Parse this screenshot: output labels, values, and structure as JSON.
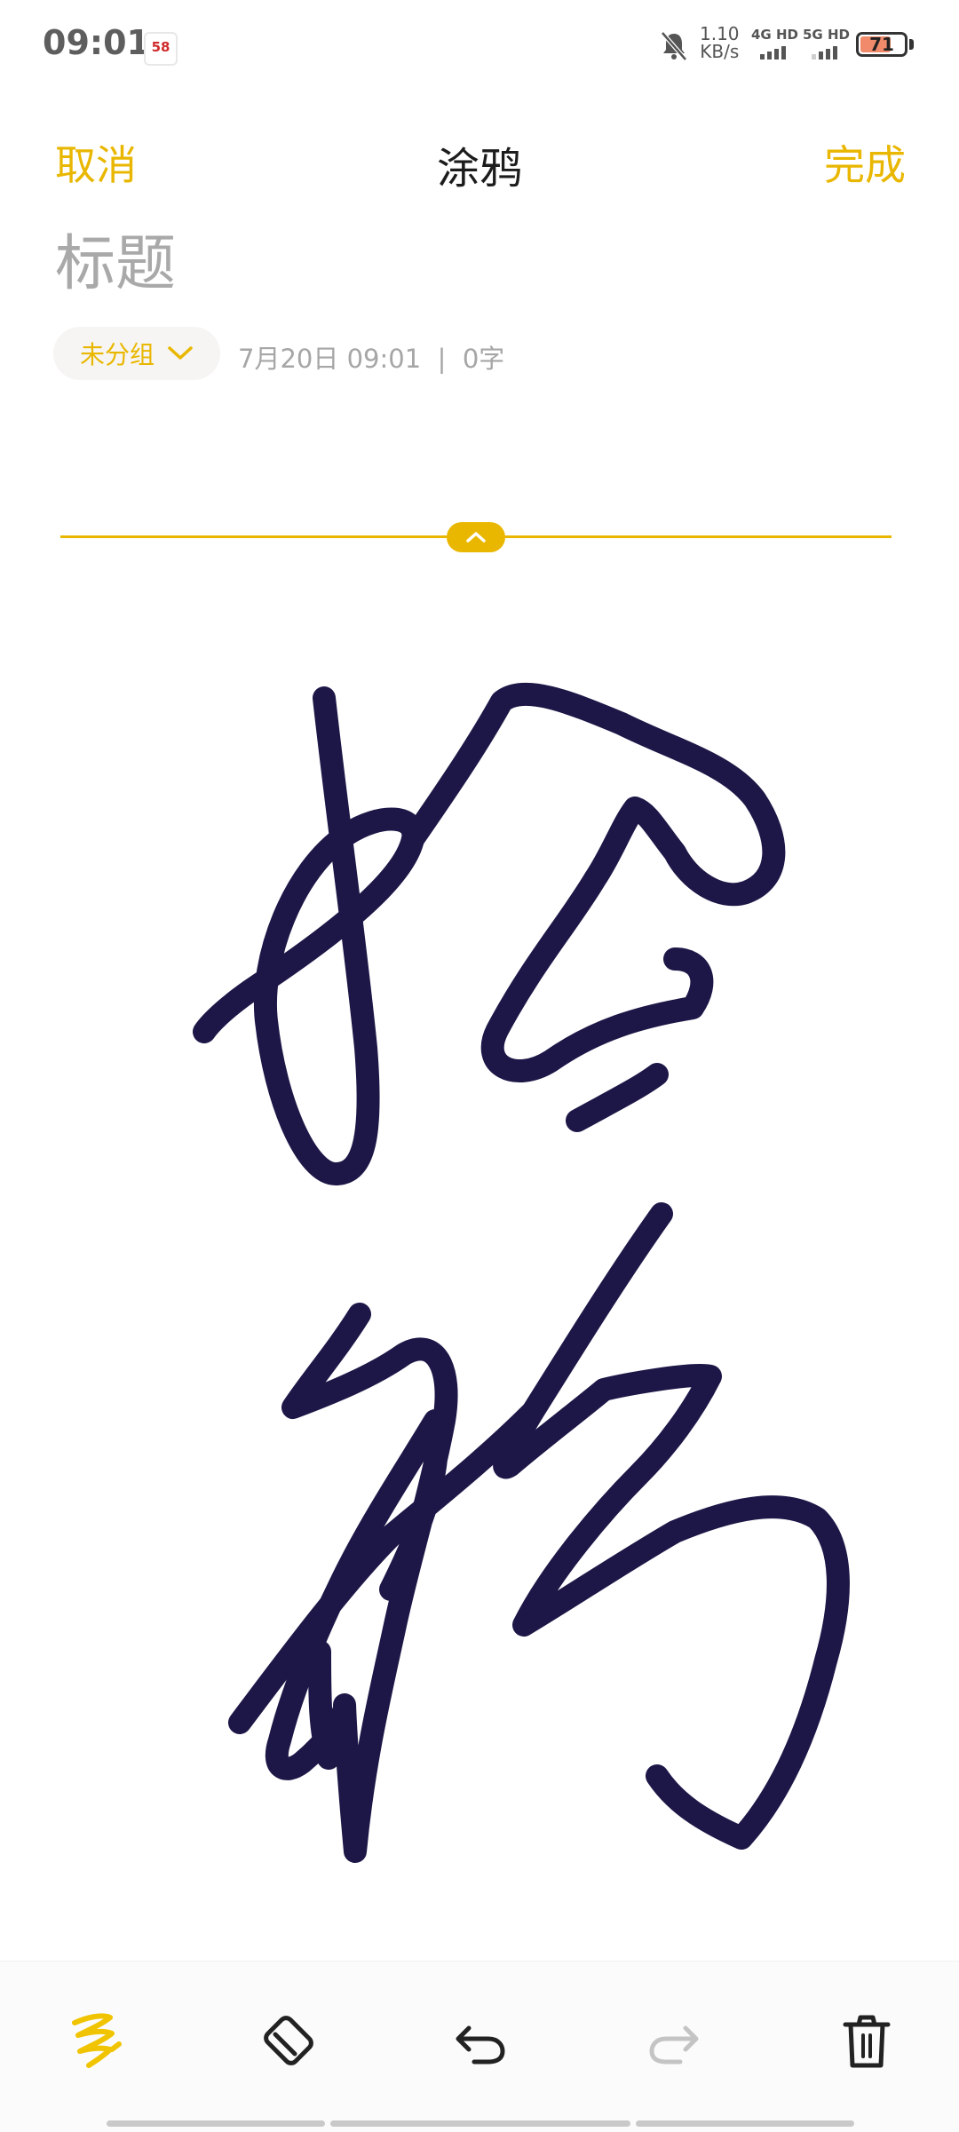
{
  "status_bar": {
    "time": "09:01",
    "app_badge": "58",
    "net_speed_value": "1.10",
    "net_speed_unit": "KB/s",
    "sim1_label": "4G HD",
    "sim2_label": "5G HD",
    "battery": "71",
    "battery_level": 0.71
  },
  "header": {
    "cancel_label": "取消",
    "title": "涂鸦",
    "done_label": "完成"
  },
  "note": {
    "title_placeholder": "标题",
    "group_label": "未分组",
    "date": "7月20日 09:01",
    "separator": "|",
    "word_count": "0字"
  },
  "toolbar": {
    "tools": [
      "pen-icon",
      "eraser-icon",
      "undo-icon",
      "redo-icon",
      "delete-icon"
    ]
  },
  "colors": {
    "accent": "#e9b700",
    "ink": "#1d1747",
    "muted": "#a6a6a6"
  }
}
